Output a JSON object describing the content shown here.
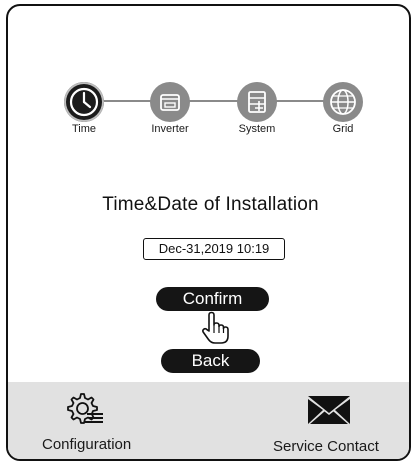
{
  "steps": [
    {
      "label": "Time",
      "icon": "clock-icon",
      "active": true
    },
    {
      "label": "Inverter",
      "icon": "inverter-icon",
      "active": false
    },
    {
      "label": "System",
      "icon": "system-icon",
      "active": false
    },
    {
      "label": "Grid",
      "icon": "globe-icon",
      "active": false
    }
  ],
  "main": {
    "title": "Time&Date of Installation",
    "datetime_value": "Dec-31,2019 10:19",
    "confirm_label": "Confirm",
    "back_label": "Back"
  },
  "footer": {
    "configuration_label": "Configuration",
    "configuration_icon": "gear-settings-icon",
    "service_label": "Service Contact",
    "service_icon": "envelope-icon"
  },
  "colors": {
    "active_step": "#1c1c1c",
    "inactive_step": "#8a8a8a",
    "button": "#151515",
    "footer_bg": "#e1e1e1"
  }
}
